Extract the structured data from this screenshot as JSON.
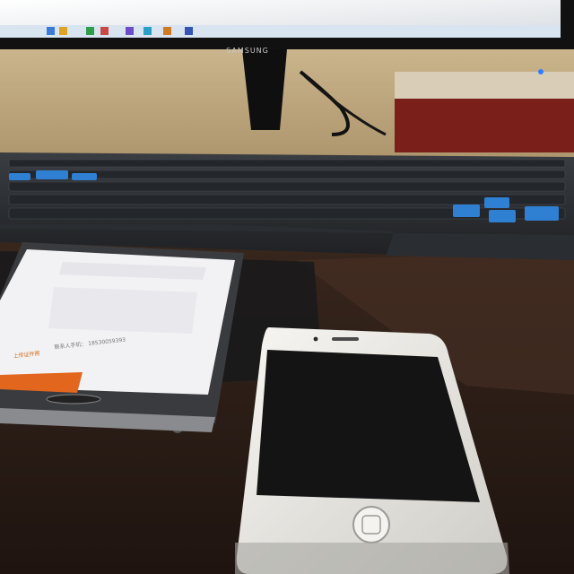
{
  "monitor": {
    "brand_logo": "SAMSUNG"
  },
  "samsung_phone_screen": {
    "lines": [
      "联系人手机： 18530059393",
      "上传证件照"
    ]
  },
  "colors": {
    "desk": "#2a1d16",
    "wall": "#c9b389",
    "monitor_bezel": "#111111",
    "keyboard": "#2c2f33",
    "keyboard_accent": "#2f7fd2",
    "iphone_body": "#ecebe6",
    "iphone_screen": "#141414",
    "samsung_body": "#3a3b3e",
    "samsung_screen": "#f2f2f4",
    "orange_banner": "#e2661e"
  }
}
